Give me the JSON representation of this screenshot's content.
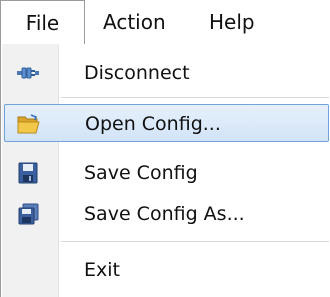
{
  "menubar": {
    "file": "File",
    "action": "Action",
    "help": "Help"
  },
  "menu": {
    "items": [
      {
        "label": "Disconnect",
        "icon": "disconnect-plug-icon"
      },
      {
        "label": "Open Config...",
        "icon": "open-folder-icon",
        "highlighted": true
      },
      {
        "label": "Save Config",
        "icon": "floppy-disk-icon"
      },
      {
        "label": "Save Config As...",
        "icon": "save-as-icon"
      },
      {
        "label": "Exit",
        "icon": null
      }
    ]
  },
  "colors": {
    "highlight_border": "#6fa3da",
    "highlight_fill": "#d2e4f8",
    "gutter": "#f1f1f1"
  }
}
